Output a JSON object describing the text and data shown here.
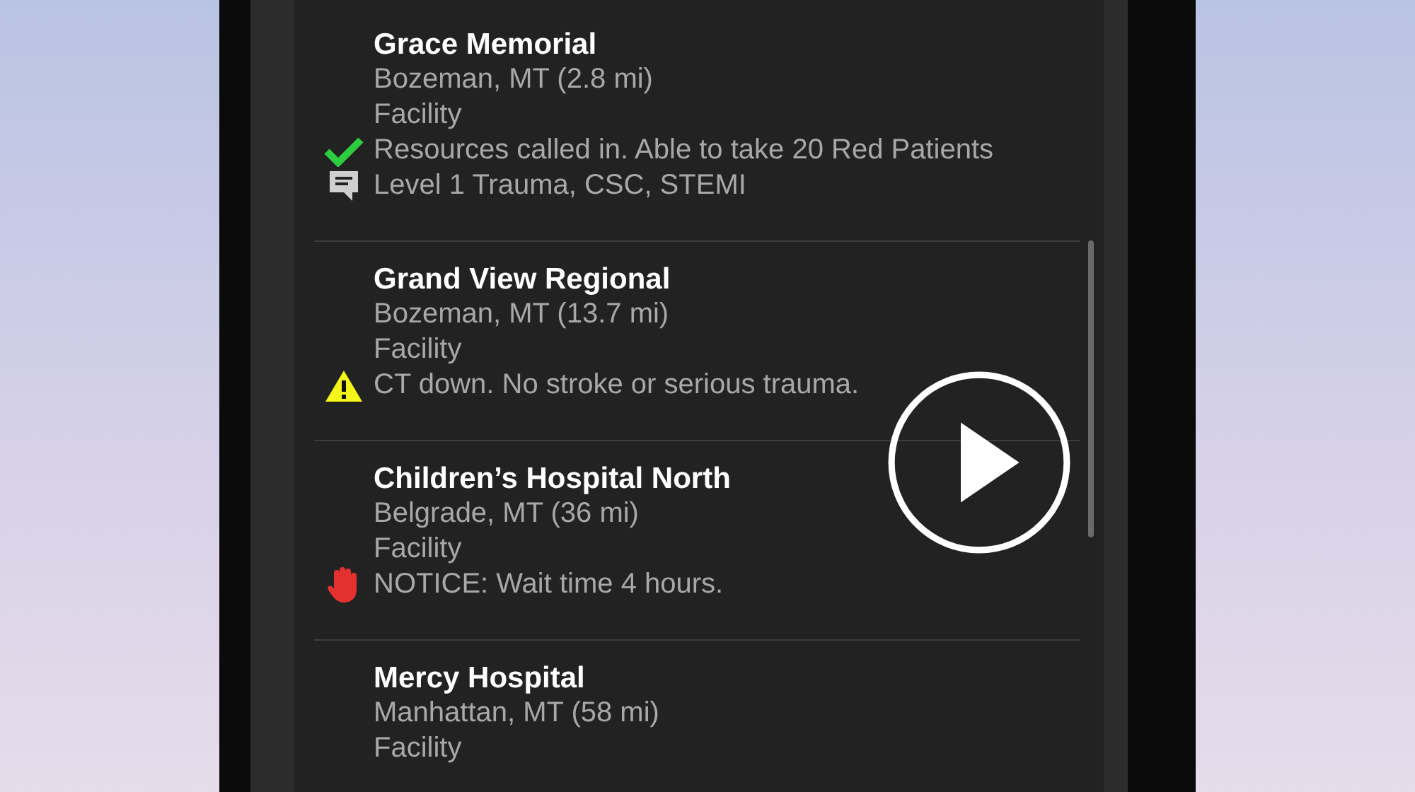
{
  "facilities": [
    {
      "name": "Grace Memorial",
      "location": "Bozeman, MT (2.8 mi)",
      "type": "Facility",
      "messages": [
        {
          "kind": "ok",
          "text": "Resources called in. Able to take 20 Red Patients"
        },
        {
          "kind": "note",
          "text": "Level 1 Trauma, CSC, STEMI"
        }
      ]
    },
    {
      "name": "Grand View Regional",
      "location": "Bozeman, MT (13.7 mi)",
      "type": "Facility",
      "messages": [
        {
          "kind": "warning",
          "text": "CT down. No stroke or serious trauma."
        }
      ]
    },
    {
      "name": "Children’s Hospital North",
      "location": "Belgrade, MT (36 mi)",
      "type": "Facility",
      "messages": [
        {
          "kind": "stop",
          "text": "NOTICE: Wait time 4 hours."
        }
      ]
    },
    {
      "name": "Mercy Hospital",
      "location": "Manhattan, MT (58 mi)",
      "type": "Facility"
    }
  ]
}
